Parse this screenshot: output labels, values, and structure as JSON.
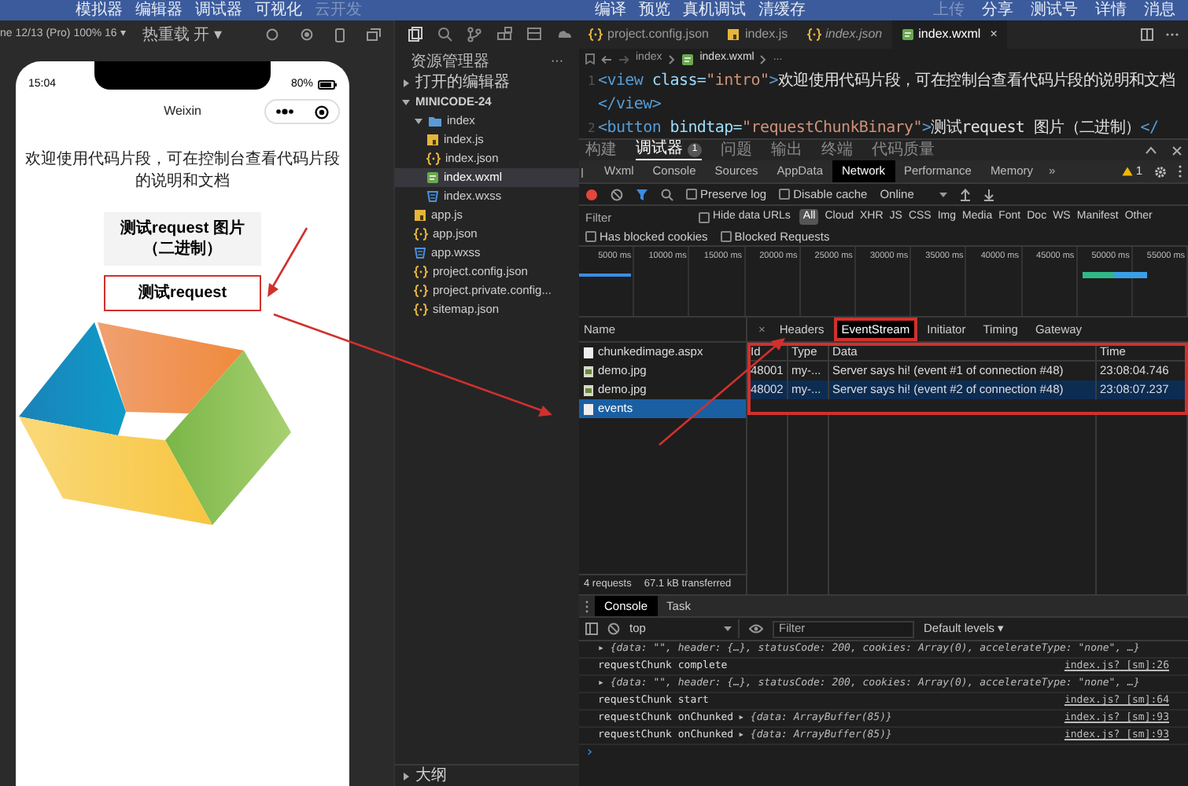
{
  "top_menu": {
    "left": [
      {
        "label": "模拟器",
        "disabled": false
      },
      {
        "label": "编辑器",
        "disabled": false
      },
      {
        "label": "调试器",
        "disabled": false
      },
      {
        "label": "可视化",
        "disabled": false
      },
      {
        "label": "云开发",
        "disabled": true
      }
    ],
    "middle": [
      {
        "label": "编译",
        "disabled": false
      },
      {
        "label": "预览",
        "disabled": false
      },
      {
        "label": "真机调试",
        "disabled": false
      },
      {
        "label": "清缓存",
        "disabled": false
      }
    ],
    "right": [
      {
        "label": "上传",
        "disabled": true
      },
      {
        "label": "分享",
        "disabled": false
      },
      {
        "label": "测试号",
        "disabled": false
      },
      {
        "label": "详情",
        "disabled": false
      },
      {
        "label": "消息",
        "disabled": false
      }
    ]
  },
  "simulator": {
    "device": "ne 12/13 (Pro) 100% 16 ▾",
    "hot_reload": "热重载 开 ▾",
    "phone": {
      "time": "15:04",
      "battery": "80%",
      "nav_title": "Weixin",
      "intro": "欢迎使用代码片段，可在控制台查看代码片段的说明和文档",
      "buttons": [
        {
          "label": "测试request 图片（二进制）",
          "highlighted": false
        },
        {
          "label": "测试request",
          "highlighted": true
        }
      ]
    }
  },
  "explorer": {
    "title": "资源管理器",
    "more": "···",
    "tree": [
      {
        "label": "打开的编辑器",
        "kind": "section",
        "expanded": false
      },
      {
        "label": "MINICODE-24",
        "kind": "section",
        "expanded": true,
        "children": [
          {
            "label": "index",
            "kind": "folder",
            "expanded": true,
            "children": [
              {
                "label": "index.js",
                "kind": "js",
                "selected": false
              },
              {
                "label": "index.json",
                "kind": "json",
                "selected": false
              },
              {
                "label": "index.wxml",
                "kind": "wxml",
                "selected": true
              },
              {
                "label": "index.wxss",
                "kind": "wxss",
                "selected": false
              }
            ]
          },
          {
            "label": "app.js",
            "kind": "js",
            "selected": false
          },
          {
            "label": "app.json",
            "kind": "json",
            "selected": false
          },
          {
            "label": "app.wxss",
            "kind": "wxss",
            "selected": false
          },
          {
            "label": "project.config.json",
            "kind": "json",
            "selected": false
          },
          {
            "label": "project.private.config...",
            "kind": "json",
            "selected": false
          },
          {
            "label": "sitemap.json",
            "kind": "json",
            "selected": false
          }
        ]
      }
    ],
    "outline": {
      "label": "大纲",
      "expanded": false
    }
  },
  "editor": {
    "tabs": [
      {
        "label": "project.config.json",
        "kind": "json",
        "selected": false,
        "preview": false
      },
      {
        "label": "index.js",
        "kind": "js",
        "selected": false,
        "preview": false
      },
      {
        "label": "index.json",
        "kind": "json",
        "selected": false,
        "preview": true
      },
      {
        "label": "index.wxml",
        "kind": "wxml",
        "selected": true,
        "preview": false,
        "close": "×"
      }
    ],
    "breadcrumb": [
      "index",
      "index.wxml",
      "..."
    ],
    "lines": [
      {
        "number": "1",
        "tokens": [
          {
            "kind": "tag",
            "text": "<view"
          },
          {
            "kind": "attr",
            "text": " class="
          },
          {
            "kind": "string",
            "text": "\"intro\""
          },
          {
            "kind": "tag",
            "text": ">"
          },
          {
            "kind": "text",
            "text": "欢迎使用代码片段，可在控制台查看代码片段的说明和文档"
          },
          {
            "kind": "tag",
            "text": "</view>"
          }
        ]
      },
      {
        "number": "2",
        "tokens": [
          {
            "kind": "tag",
            "text": "<button"
          },
          {
            "kind": "attr",
            "text": " bindtap="
          },
          {
            "kind": "string",
            "text": "\"requestChunkBinary\""
          },
          {
            "kind": "tag",
            "text": ">"
          },
          {
            "kind": "text",
            "text": "测试request 图片（二进制）"
          },
          {
            "kind": "tag",
            "text": "</"
          }
        ]
      }
    ]
  },
  "devtools": {
    "panel_tabs": [
      {
        "label": "构建",
        "selected": false
      },
      {
        "label": "调试器",
        "selected": true,
        "badge": "1"
      },
      {
        "label": "问题",
        "selected": false
      },
      {
        "label": "输出",
        "selected": false
      },
      {
        "label": "终端",
        "selected": false
      },
      {
        "label": "代码质量",
        "selected": false
      }
    ],
    "tabs": [
      {
        "label": "Wxml",
        "selected": false
      },
      {
        "label": "Console",
        "selected": false
      },
      {
        "label": "Sources",
        "selected": false
      },
      {
        "label": "AppData",
        "selected": false
      },
      {
        "label": "Network",
        "selected": true
      },
      {
        "label": "Performance",
        "selected": false
      },
      {
        "label": "Memory",
        "selected": false
      }
    ],
    "more_tabs": "»",
    "warnings": "1",
    "network": {
      "preserve_log": {
        "label": "Preserve log",
        "checked": false
      },
      "disable_cache": {
        "label": "Disable cache",
        "checked": false
      },
      "throttling": "Online",
      "filter_placeholder": "Filter",
      "hide_data_urls": {
        "label": "Hide data URLs",
        "checked": false
      },
      "types": [
        {
          "label": "All",
          "selected": true
        },
        {
          "label": "Cloud",
          "selected": false
        },
        {
          "label": "XHR",
          "selected": false
        },
        {
          "label": "JS",
          "selected": false
        },
        {
          "label": "CSS",
          "selected": false
        },
        {
          "label": "Img",
          "selected": false
        },
        {
          "label": "Media",
          "selected": false
        },
        {
          "label": "Font",
          "selected": false
        },
        {
          "label": "Doc",
          "selected": false
        },
        {
          "label": "WS",
          "selected": false
        },
        {
          "label": "Manifest",
          "selected": false
        },
        {
          "label": "Other",
          "selected": false
        }
      ],
      "blocked_cookies": {
        "label": "Has blocked cookies",
        "checked": false
      },
      "blocked_requests": {
        "label": "Blocked Requests",
        "checked": false
      },
      "timeline_ticks": [
        "5000 ms",
        "10000 ms",
        "15000 ms",
        "20000 ms",
        "25000 ms",
        "30000 ms",
        "35000 ms",
        "40000 ms",
        "45000 ms",
        "50000 ms",
        "55000 ms"
      ],
      "name_header": "Name",
      "requests": [
        {
          "name": "chunkedimage.aspx",
          "kind": "document",
          "selected": false
        },
        {
          "name": "demo.jpg",
          "kind": "image",
          "selected": false
        },
        {
          "name": "demo.jpg",
          "kind": "image",
          "selected": false
        },
        {
          "name": "events",
          "kind": "document",
          "selected": true
        }
      ],
      "summary": [
        "4 requests",
        "67.1 kB transferred"
      ],
      "detail_close": "×",
      "detail_tabs": [
        {
          "label": "Headers",
          "selected": false,
          "highlighted": false
        },
        {
          "label": "EventStream",
          "selected": true,
          "highlighted": true
        },
        {
          "label": "Initiator",
          "selected": false,
          "highlighted": false
        },
        {
          "label": "Timing",
          "selected": false,
          "highlighted": false
        },
        {
          "label": "Gateway",
          "selected": false,
          "highlighted": false
        }
      ],
      "events": {
        "highlighted": true,
        "columns": [
          "Id",
          "Type",
          "Data",
          "Time"
        ],
        "rows": [
          {
            "id": "48001",
            "type": "my-...",
            "data": "Server says hi! (event #1 of connection #48)",
            "time": "23:08:04.746",
            "selected": false
          },
          {
            "id": "48002",
            "type": "my-...",
            "data": "Server says hi! (event #2 of connection #48)",
            "time": "23:08:07.237",
            "selected": true
          }
        ]
      }
    }
  },
  "console": {
    "tabs": [
      {
        "label": "Console",
        "selected": true
      },
      {
        "label": "Task",
        "selected": false
      }
    ],
    "context": "top",
    "filter_placeholder": "Filter",
    "levels": "Default levels ▾",
    "logs": [
      {
        "message": "▸ {data: \"\", header: {…}, statusCode: 200, cookies: Array(0), accelerateType: \"none\", …}",
        "kind": "object"
      },
      {
        "message": "requestChunk complete",
        "kind": "text",
        "source": "index.js? [sm]:26"
      },
      {
        "message": "▸ {data: \"\", header: {…}, statusCode: 200, cookies: Array(0), accelerateType: \"none\", …}",
        "kind": "object"
      },
      {
        "message": "requestChunk start",
        "kind": "text",
        "source": "index.js? [sm]:64"
      },
      {
        "message": "requestChunk onChunked",
        "object": "▸ {data: ArrayBuffer(85)}",
        "kind": "text",
        "source": "index.js? [sm]:93"
      },
      {
        "message": "requestChunk onChunked",
        "object": "▸ {data: ArrayBuffer(85)}",
        "kind": "text",
        "source": "index.js? [sm]:93"
      }
    ],
    "prompt": "›"
  }
}
